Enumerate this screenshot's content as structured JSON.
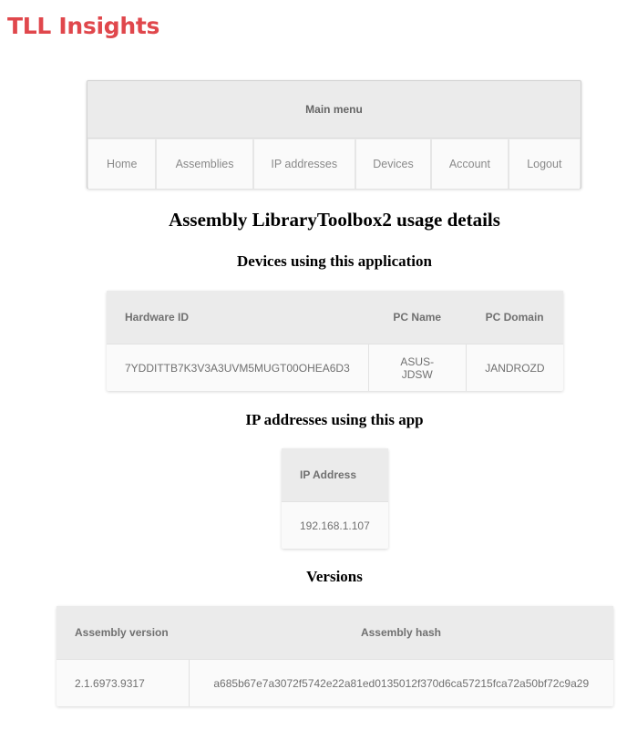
{
  "brand": {
    "title": "TLL Insights",
    "color": "#e0474c"
  },
  "menu": {
    "title": "Main menu",
    "items": [
      {
        "label": "Home"
      },
      {
        "label": "Assemblies"
      },
      {
        "label": "IP addresses"
      },
      {
        "label": "Devices"
      },
      {
        "label": "Account"
      },
      {
        "label": "Logout"
      }
    ]
  },
  "page": {
    "title": "Assembly LibraryToolbox2 usage details"
  },
  "devices": {
    "heading": "Devices using this application",
    "columns": [
      "Hardware ID",
      "PC Name",
      "PC Domain"
    ],
    "rows": [
      [
        "7YDDITTB7K3V3A3UVM5MUGT00OHEA6D3",
        "ASUS-JDSW",
        "JANDROZD"
      ]
    ]
  },
  "ips": {
    "heading": "IP addresses using this app",
    "columns": [
      "IP Address"
    ],
    "rows": [
      [
        "192.168.1.107"
      ]
    ]
  },
  "versions": {
    "heading": "Versions",
    "columns": [
      "Assembly version",
      "Assembly hash"
    ],
    "rows": [
      [
        "2.1.6973.9317",
        "a685b67e7a3072f5742e22a81ed0135012f370d6ca57215fca72a50bf72c9a29"
      ]
    ]
  }
}
